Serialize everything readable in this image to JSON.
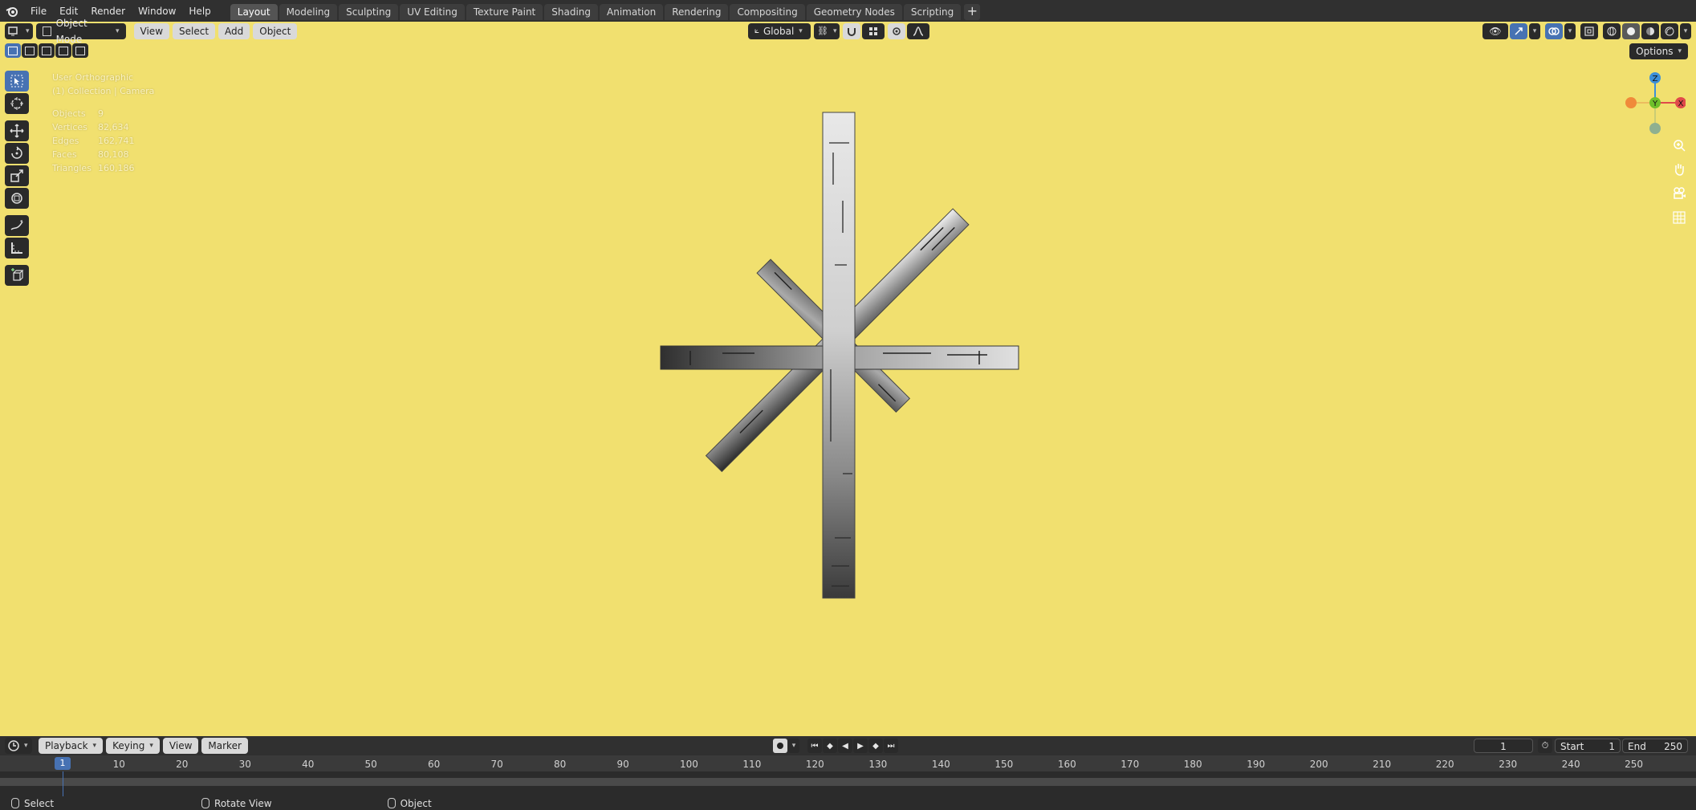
{
  "topbar": {
    "menus": [
      "File",
      "Edit",
      "Render",
      "Window",
      "Help"
    ],
    "workspaces": [
      "Layout",
      "Modeling",
      "Sculpting",
      "UV Editing",
      "Texture Paint",
      "Shading",
      "Animation",
      "Rendering",
      "Compositing",
      "Geometry Nodes",
      "Scripting"
    ],
    "active_workspace": "Layout",
    "add_label": "+"
  },
  "viewport_header": {
    "mode": "Object Mode",
    "menus": [
      "View",
      "Select",
      "Add",
      "Object"
    ],
    "transform_orientation": "Global",
    "options_label": "Options"
  },
  "viewport": {
    "view_name": "User Orthographic",
    "collection": "(1) Collection | Camera",
    "stats": [
      {
        "label": "Objects",
        "value": "9"
      },
      {
        "label": "Vertices",
        "value": "82,634"
      },
      {
        "label": "Edges",
        "value": "162,741"
      },
      {
        "label": "Faces",
        "value": "80,108"
      },
      {
        "label": "Triangles",
        "value": "160,186"
      }
    ],
    "background_color": "#f1e06f",
    "gizmo": {
      "z": "Z",
      "y": "Y",
      "x": "X"
    }
  },
  "timeline": {
    "menus": [
      "Playback",
      "Keying",
      "View",
      "Marker"
    ],
    "current_frame": "1",
    "start_label": "Start",
    "start_value": "1",
    "end_label": "End",
    "end_value": "250",
    "ticks": [
      "10",
      "20",
      "30",
      "40",
      "50",
      "60",
      "70",
      "80",
      "90",
      "100",
      "110",
      "120",
      "130",
      "140",
      "150",
      "160",
      "170",
      "180",
      "190",
      "200",
      "210",
      "220",
      "230",
      "240",
      "250"
    ],
    "frame_marker": "1"
  },
  "statusbar": {
    "select": "Select",
    "rotate": "Rotate View",
    "object": "Object"
  },
  "colors": {
    "accent": "#4772b3",
    "x_axis": "#e04a4a",
    "y_axis": "#6fbf2a",
    "z_axis": "#3c8fd9"
  }
}
